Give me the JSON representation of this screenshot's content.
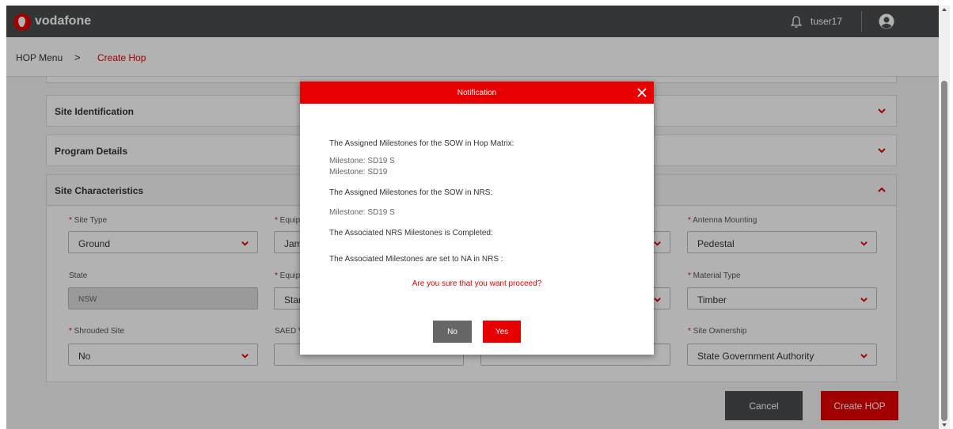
{
  "header": {
    "brand": "vodafone",
    "username": "tuser17",
    "icons": {
      "logo": "vodafone-logo-icon",
      "notification": "bell-icon",
      "profile": "user-circle-icon"
    }
  },
  "breadcrumb": {
    "home": "HOP Menu",
    "separator": ">",
    "current": "Create Hop"
  },
  "sections": [
    {
      "title": "Site Identification",
      "expanded": false
    },
    {
      "title": "Program Details",
      "expanded": false
    },
    {
      "title": "Site Characteristics",
      "expanded": true
    }
  ],
  "site_characteristics": {
    "row1": [
      {
        "label": "Site Type",
        "required": true,
        "value": "Ground"
      },
      {
        "label": "Equipr",
        "required": true,
        "value": "Jame"
      },
      {
        "label": "",
        "required": false,
        "value": ""
      },
      {
        "label": "Antenna Mounting",
        "required": true,
        "value": "Pedestal"
      }
    ],
    "row2": [
      {
        "label": "State",
        "required": false,
        "value": "NSW",
        "disabled": true
      },
      {
        "label": "Equipr",
        "required": true,
        "value": "Stan"
      },
      {
        "label": "",
        "required": false,
        "value": ""
      },
      {
        "label": "Material Type",
        "required": true,
        "value": "Timber"
      }
    ],
    "row3": [
      {
        "label": "Shrouded Site",
        "required": true,
        "value": "No"
      },
      {
        "label": "SAED Ve",
        "required": false,
        "value": ""
      },
      {
        "label": "",
        "required": false,
        "value": ""
      },
      {
        "label": "Site Ownership",
        "required": true,
        "value": "State Government Authority"
      }
    ]
  },
  "actions": {
    "cancel": "Cancel",
    "create": "Create HOP"
  },
  "modal": {
    "title": "Notification",
    "heading_hop": "The Assigned Milestones for the SOW in Hop Matrix:",
    "hop_items": [
      "Milestone: SD19 S",
      "Milestone: SD19"
    ],
    "heading_nrs": "The Assigned Milestones for the SOW in NRS:",
    "nrs_items": [
      "Milestone: SD19 S"
    ],
    "heading_completed": "The Associated NRS Milestones is Completed:",
    "heading_na": "The Associated Milestones are set to NA in NRS :",
    "question": "Are you sure that you want proceed?",
    "no_label": "No",
    "yes_label": "Yes"
  },
  "colors": {
    "brand_red": "#e60000",
    "header_gray": "#4a4d4e",
    "button_gray": "#666666"
  }
}
